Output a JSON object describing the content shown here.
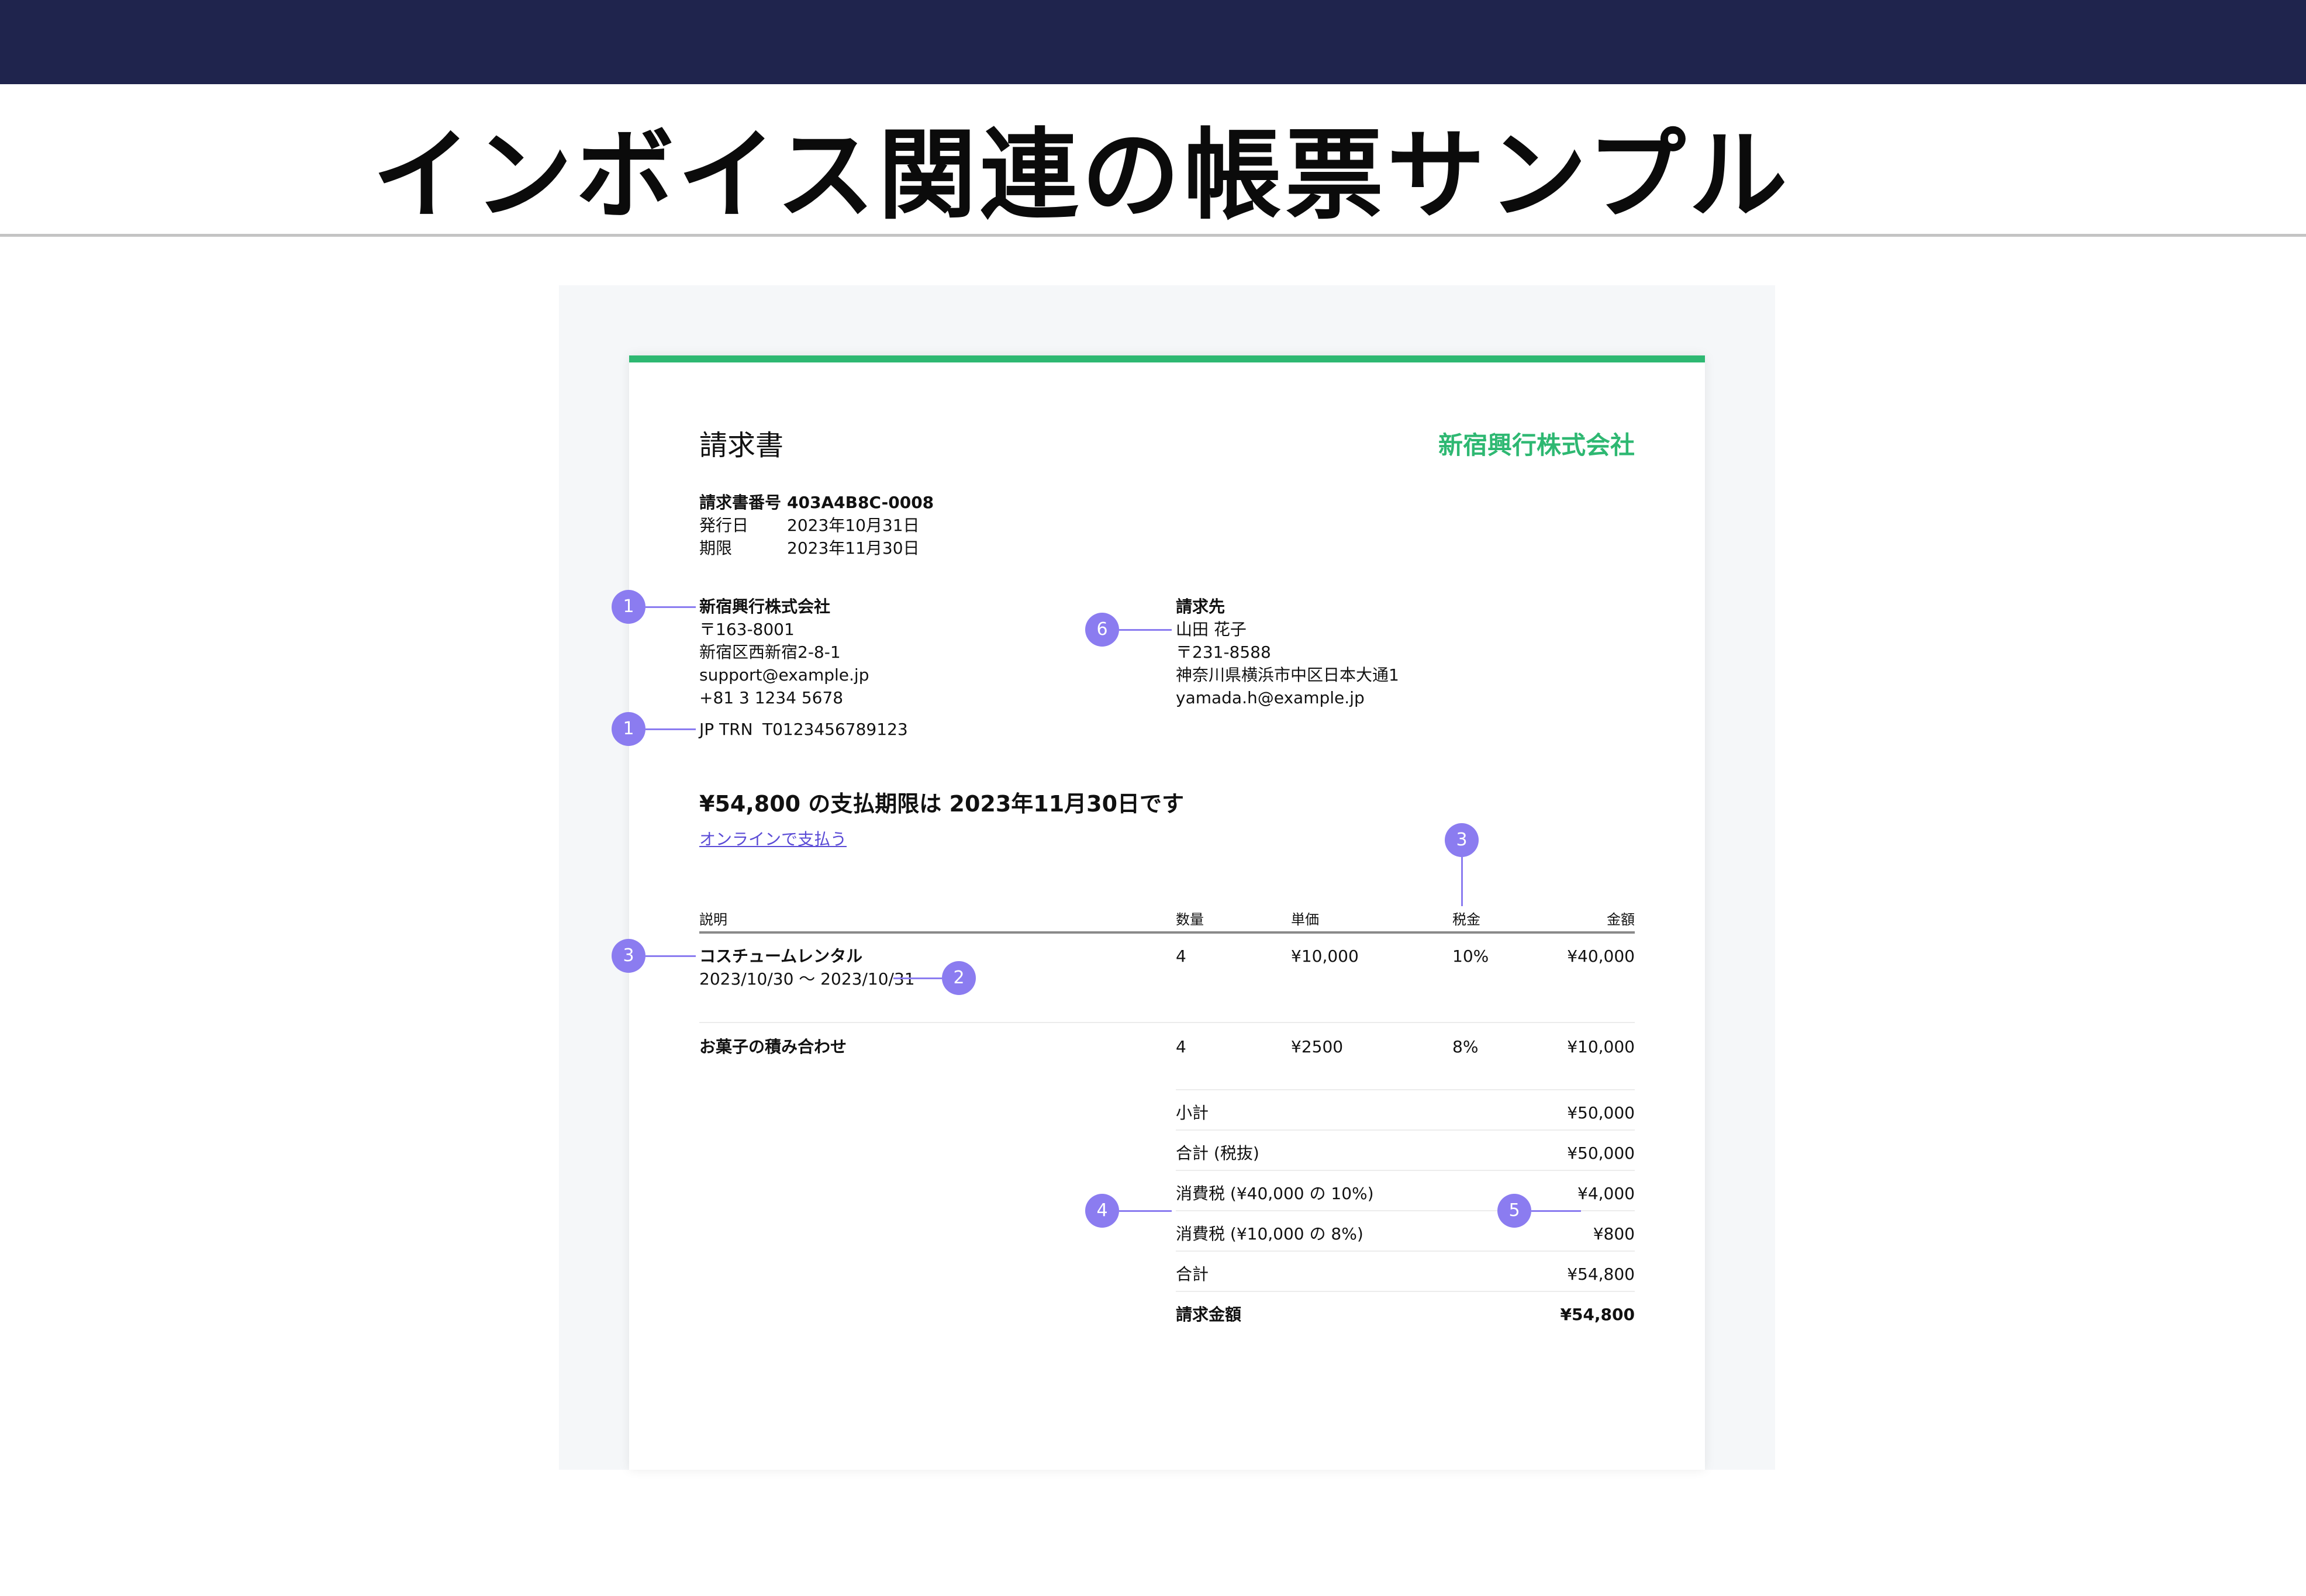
{
  "page": {
    "title": "インボイス関連の帳票サンプル"
  },
  "invoice": {
    "title": "請求書",
    "issuer_logo_text": "新宿興行株式会社",
    "meta": [
      {
        "label": "請求書番号",
        "value": "403A4B8C-0008"
      },
      {
        "label": "発行日",
        "value": "2023年10月31日"
      },
      {
        "label": "期限",
        "value": "2023年11月30日"
      }
    ],
    "issuer": {
      "name": "新宿興行株式会社",
      "postal": "〒163-8001",
      "address": "新宿区西新宿2-8-1",
      "email": "support@example.jp",
      "phone": "+81 3 1234 5678",
      "trn_label": "JP TRN",
      "trn_value": "T0123456789123"
    },
    "bill_to": {
      "heading": "請求先",
      "name": "山田 花子",
      "postal": "〒231-8588",
      "address": "神奈川県横浜市中区日本大通1",
      "email": "yamada.h@example.jp"
    },
    "due_summary": "¥54,800 の支払期限は 2023年11月30日です",
    "pay_online_link": "オンラインで支払う",
    "table": {
      "headers": {
        "description": "説明",
        "qty": "数量",
        "unit_price": "単価",
        "tax": "税金",
        "amount": "金額"
      },
      "rows": [
        {
          "description": "コスチュームレンタル",
          "period": "2023/10/30 〜 2023/10/31",
          "qty": "4",
          "unit_price": "¥10,000",
          "tax": "10%",
          "amount": "¥40,000"
        },
        {
          "description": "お菓子の積み合わせ",
          "qty": "4",
          "unit_price": "¥2500",
          "tax": "8%",
          "amount": "¥10,000"
        }
      ]
    },
    "totals": [
      {
        "label": "小計",
        "value": "¥50,000"
      },
      {
        "label": "合計 (税抜)",
        "value": "¥50,000"
      },
      {
        "label": "消費税 (¥40,000 の 10%)",
        "value": "¥4,000"
      },
      {
        "label": "消費税 (¥10,000 の 8%)",
        "value": "¥800"
      },
      {
        "label": "合計",
        "value": "¥54,800"
      },
      {
        "label": "請求金額",
        "value": "¥54,800"
      }
    ]
  },
  "annotations": {
    "issuer_name": "1",
    "issuer_trn": "1",
    "period": "2",
    "tax_header": "3",
    "item_description": "3",
    "tax_breakdown": "4",
    "tax_amounts": "5",
    "bill_to": "6"
  },
  "colors": {
    "header_bar": "#1f244d",
    "accent_green": "#2eb872",
    "marker_purple": "#8b7cf0",
    "link": "#5b4cd6"
  }
}
